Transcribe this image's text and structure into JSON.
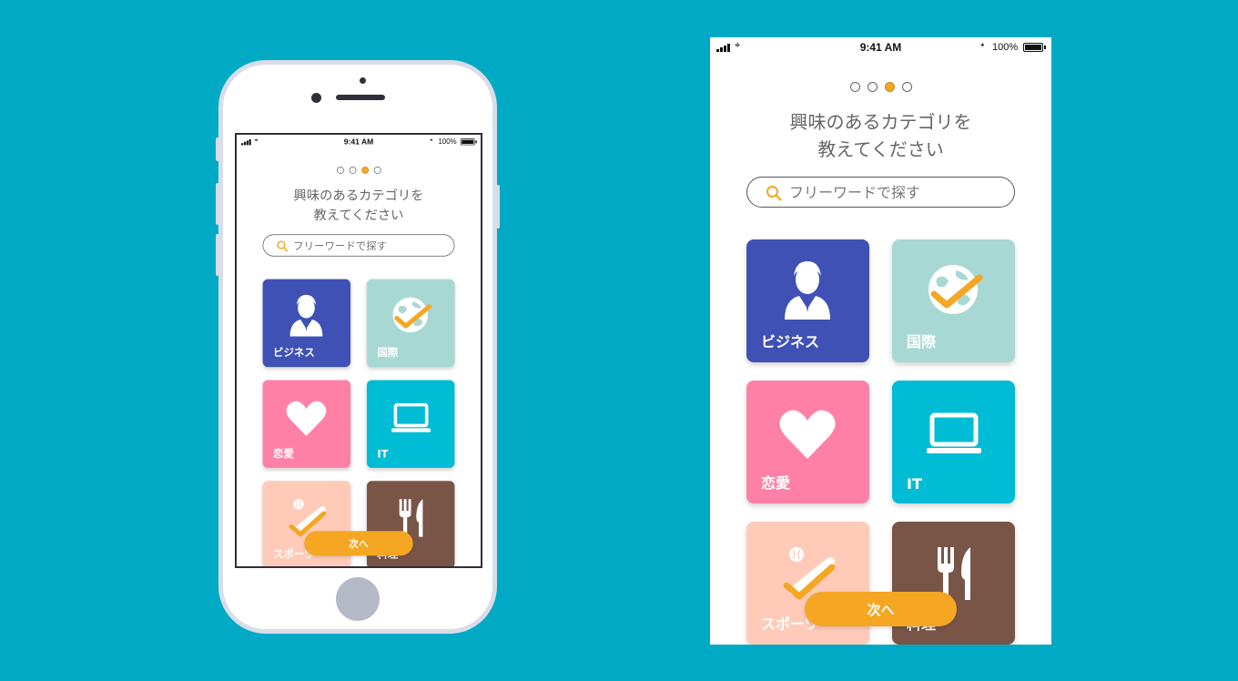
{
  "status": {
    "time": "9:41 AM",
    "battery": "100%"
  },
  "onboarding": {
    "title_line1": "興味のあるカテゴリを",
    "title_line2": "教えてください",
    "search_placeholder": "フリーワードで探す",
    "step_current": 3,
    "step_total": 4,
    "next_label": "次へ"
  },
  "categories": [
    {
      "label": "ビジネス",
      "color": "#3f51b5",
      "icon": "businessman-icon"
    },
    {
      "label": "国際",
      "color": "#a8d8d4",
      "icon": "globe-check-icon"
    },
    {
      "label": "恋愛",
      "color": "#ff80a6",
      "icon": "heart-icon"
    },
    {
      "label": "IT",
      "color": "#00bcd4",
      "icon": "laptop-icon"
    },
    {
      "label": "スポーツ",
      "color": "#ffcbb8",
      "icon": "baseball-bat-icon"
    },
    {
      "label": "料理",
      "color": "#795548",
      "icon": "fork-knife-icon"
    }
  ],
  "accent_color": "#f5a623",
  "background_color": "#00a9c4"
}
